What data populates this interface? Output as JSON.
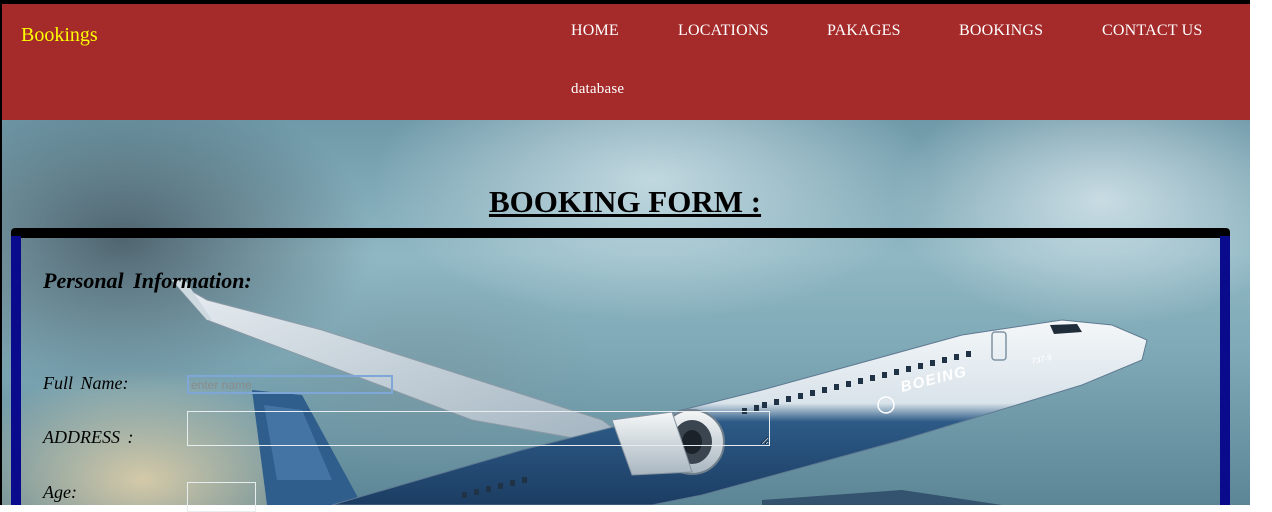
{
  "header": {
    "brand": "Bookings",
    "nav": [
      "HOME",
      "LOCATIONS",
      "PAKAGES",
      "BOOKINGS",
      "CONTACT US",
      "database"
    ]
  },
  "form": {
    "title": "BOOKING FORM :",
    "section_heading": "Personal  Information:",
    "full_name_label": "Full  Name:",
    "full_name_placeholder": "enter name",
    "address_label": "ADDRESS  :",
    "age_label": "Age:"
  },
  "colors": {
    "navbar": "#a52a2a",
    "brand": "#ffff00",
    "frame": "#0a0a8c"
  },
  "hero": {
    "aircraft_marking": "BOEING",
    "aircraft_model": "737-9"
  }
}
